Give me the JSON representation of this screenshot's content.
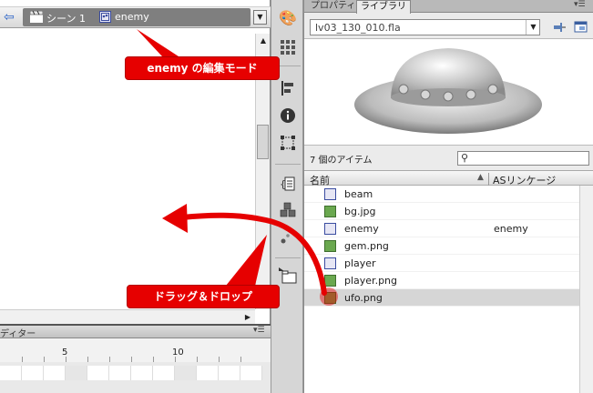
{
  "scene_bar": {
    "scene_label": "シーン 1",
    "symbol_label": "enemy"
  },
  "timeline": {
    "title": "ディター",
    "ruler_labels": [
      "5",
      "10"
    ]
  },
  "library": {
    "tabs": {
      "properties": "プロパティ",
      "library": "ライブラリ"
    },
    "file": "lv03_130_010.fla",
    "item_count": "7 個のアイテム",
    "columns": {
      "name": "名前",
      "linkage": "ASリンケージ"
    },
    "items": [
      {
        "name": "beam",
        "type": "symbol",
        "linkage": ""
      },
      {
        "name": "bg.jpg",
        "type": "bitmap",
        "linkage": ""
      },
      {
        "name": "enemy",
        "type": "symbol",
        "linkage": "enemy"
      },
      {
        "name": "gem.png",
        "type": "bitmap",
        "linkage": ""
      },
      {
        "name": "player",
        "type": "symbol",
        "linkage": ""
      },
      {
        "name": "player.png",
        "type": "bitmap",
        "linkage": ""
      },
      {
        "name": "ufo.png",
        "type": "bitmap",
        "linkage": ""
      }
    ]
  },
  "annotations": {
    "mode_callout": "enemy の編集モード",
    "drag_callout": "ドラッグ＆ドロップ"
  },
  "colors": {
    "callout": "#e60000",
    "accent": "#2a63c8"
  }
}
